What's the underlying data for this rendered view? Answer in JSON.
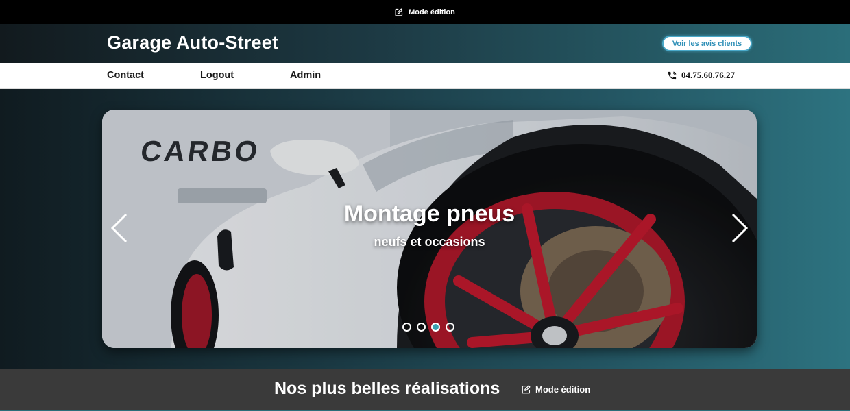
{
  "admin_bar": {
    "edit_icon": "edit-icon",
    "label": "Mode édition"
  },
  "header": {
    "brand": "Garage Auto-Street",
    "reviews_button": "Voir les avis clients"
  },
  "nav": {
    "items": [
      {
        "label": "Contact"
      },
      {
        "label": "Logout"
      },
      {
        "label": "Admin"
      }
    ],
    "phone_icon": "phone-icon",
    "phone": "04.75.60.76.27"
  },
  "carousel": {
    "title": "Montage pneus",
    "subtitle": "neufs et occasions",
    "slide_count": 4,
    "active_index": 2,
    "prev_icon": "chevron-left-icon",
    "next_icon": "chevron-right-icon"
  },
  "section": {
    "title": "Nos plus belles réalisations",
    "edit_label": "Mode édition",
    "edit_icon": "edit-icon"
  },
  "colors": {
    "accent": "#2e8fb7",
    "active_dot": "#3aa0b0",
    "rim_red": "#c21a2e",
    "section_bg": "#3a3a3a"
  }
}
